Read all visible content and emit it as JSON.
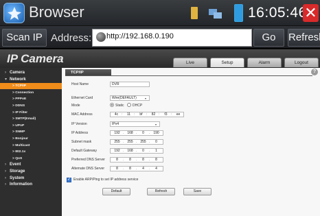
{
  "app": {
    "title": "Browser",
    "clock": "16:05:46",
    "close_label": "✕",
    "icons": [
      "browser-logo-icon",
      "sd-card-icon",
      "network-icon",
      "battery-icon"
    ]
  },
  "navbar": {
    "scan_label": "Scan IP",
    "address_label": "Address:",
    "address_value": "http://192.168.0.190",
    "go_label": "Go",
    "refresh_label": "Refresh"
  },
  "camera": {
    "logo": "IP Camera",
    "tabs": [
      {
        "label": "Live"
      },
      {
        "label": "Setup",
        "active": true
      },
      {
        "label": "Alarm"
      },
      {
        "label": "Logout"
      }
    ],
    "sidebar": [
      {
        "label": "Camera",
        "level": "top",
        "caret": "›"
      },
      {
        "label": "Network",
        "level": "top",
        "caret": "▾"
      },
      {
        "label": "TCP/IP",
        "level": "sub",
        "active": true
      },
      {
        "label": "Connection",
        "level": "sub"
      },
      {
        "label": "PPPoE",
        "level": "sub"
      },
      {
        "label": "DDNS",
        "level": "sub"
      },
      {
        "label": "IP Filter",
        "level": "sub"
      },
      {
        "label": "SMTP(Email)",
        "level": "sub"
      },
      {
        "label": "UPnP",
        "level": "sub"
      },
      {
        "label": "SNMP",
        "level": "sub"
      },
      {
        "label": "Bonjour",
        "level": "sub"
      },
      {
        "label": "Multicast",
        "level": "sub"
      },
      {
        "label": "802.1x",
        "level": "sub"
      },
      {
        "label": "QoS",
        "level": "sub"
      },
      {
        "label": "Event",
        "level": "top",
        "caret": "›"
      },
      {
        "label": "Storage",
        "level": "top",
        "caret": "›"
      },
      {
        "label": "System",
        "level": "top",
        "caret": "›"
      },
      {
        "label": "Information",
        "level": "top",
        "caret": "›"
      }
    ],
    "panel_title": "TCP/IP",
    "help": "?",
    "form": {
      "host_name_label": "Host Name",
      "host_name_value": "DVR",
      "ethernet_card_label": "Ethernet Card",
      "ethernet_card_value": "Wire(DEFAULT)",
      "mode_label": "Mode",
      "mode_static": "Static",
      "mode_dhcp": "DHCP",
      "mode_selected": "Static",
      "mac_label": "MAC Address",
      "mac_value": [
        "4c",
        "11",
        "bf",
        "82",
        "f3",
        "ee"
      ],
      "ip_version_label": "IP Version",
      "ip_version_value": "IPv4",
      "ip_address_label": "IP Address",
      "ip_address_value": [
        "192",
        "168",
        "0",
        "190"
      ],
      "subnet_label": "Subnet mask",
      "subnet_value": [
        "255",
        "255",
        "255",
        "0"
      ],
      "gateway_label": "Default Gateway",
      "gateway_value": [
        "192",
        "168",
        "0",
        "1"
      ],
      "pdns_label": "Preferred DNS Server",
      "pdns_value": [
        "8",
        "8",
        "8",
        "8"
      ],
      "adns_label": "Alternate DNS Server",
      "adns_value": [
        "8",
        "8",
        "4",
        "4"
      ],
      "arp_label": "Enable ARP/Ping to set IP address service",
      "arp_checked": true,
      "default_label": "Default",
      "refresh_label": "Refresh",
      "save_label": "Save"
    }
  }
}
